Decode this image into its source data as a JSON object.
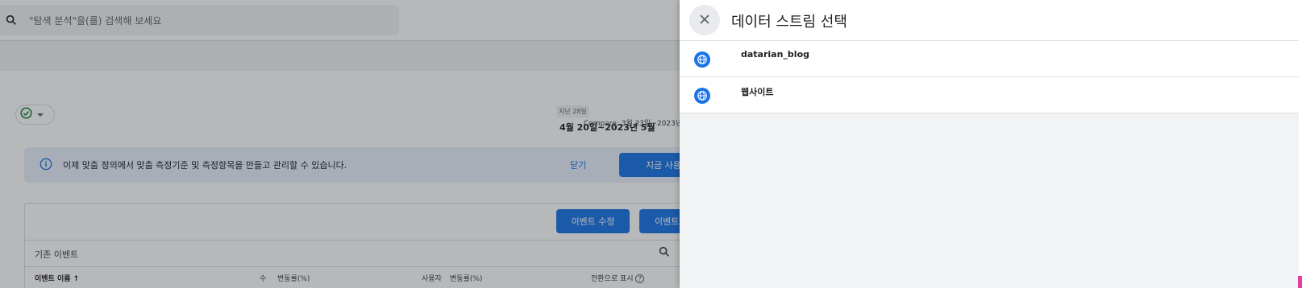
{
  "background": {
    "search": {
      "placeholder": "\"탐색 분석\"을(를) 검색해 보세요"
    },
    "date": {
      "range_badge": "지난 28일",
      "range": "4월 20일~2023년 5월",
      "compare": "Compare: 3월 23일~2023년"
    },
    "banner": {
      "message": "이제 맞춤 정의에서 맞춤 측정기준 및 측정항목을 만들고 관리할 수 있습니다.",
      "dismiss_label": "닫기",
      "action_label": "지금 사용해"
    },
    "events_card": {
      "edit_button": "이벤트 수정",
      "create_button": "이벤트",
      "section_title": "기존 이벤트",
      "columns": {
        "event_name": "이벤트 이름 ↑",
        "count": "수",
        "count_change": "변동률(%)",
        "users": "사용자",
        "users_change": "변동률(%)",
        "mark_conversion": "전환으로 표시"
      }
    }
  },
  "drawer": {
    "title": "데이터 스트림 선택",
    "streams": [
      {
        "name": "datarian_blog",
        "icon": "globe-icon"
      },
      {
        "name": "웹사이트",
        "icon": "globe-icon"
      }
    ]
  },
  "colors": {
    "accent": "#1a73e8",
    "banner_bg": "#e8f0fe",
    "status_ok": "#188038"
  }
}
